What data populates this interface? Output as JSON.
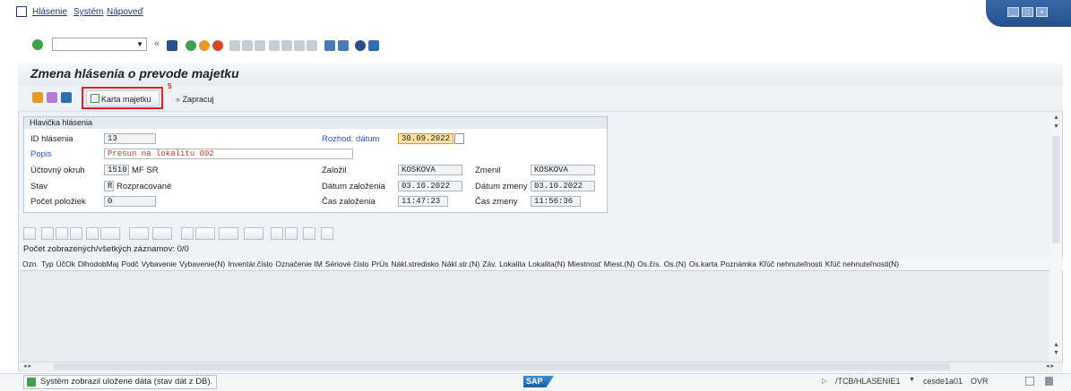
{
  "menu": {
    "items": [
      "Hlásenie",
      "Systém",
      "Nápoveď"
    ]
  },
  "page_title": "Zmena hlásenia o prevode majetku",
  "app_toolbar": {
    "karta_majetku": "Karta majetku",
    "zapracuj": "Zapracuj",
    "step_marker": "5"
  },
  "header_group": {
    "title": "Hlavička hlásenia",
    "id_label": "ID hlásenia",
    "id_value": "13",
    "popis_label": "Popis",
    "popis_value": "Presun na lokalitu 002",
    "uctovny_label": "Účtovný okruh",
    "uctovny_code": "1510",
    "uctovny_name": "MF SR",
    "stav_label": "Stav",
    "stav_code": "R",
    "stav_name": "Rozpracované",
    "pocet_label": "Počet položiek",
    "pocet_value": "0",
    "rozhod_label": "Rozhod. dátum",
    "rozhod_value": "30.09.2022",
    "zalozil_label": "Založil",
    "zalozil_value": "KOSKOVA",
    "zmenil_label": "Zmenil",
    "zmenil_value": "KOSKOVA",
    "datum_zal_label": "Dátum založenia",
    "datum_zal_value": "03.10.2022",
    "datum_zm_label": "Dátum zmeny",
    "datum_zm_value": "03.10.2022",
    "cas_zal_label": "Čas založenia",
    "cas_zal_value": "11:47:23",
    "cas_zm_label": "Čas zmeny",
    "cas_zm_value": "11:56:36"
  },
  "grid": {
    "count_text": "Počet zobrazených/všetkých záznamov: 0/0",
    "columns": [
      "Ozn.",
      "Typ",
      "ÚčOk",
      "DlhodobMaj",
      "Podč",
      "Vybavenie",
      "Vybavenie(N)",
      "Inventár.číslo",
      "Označenie IM",
      "Sériové číslo",
      "PrÚs",
      "Nákl.stredisko",
      "Nákl.str.(N)",
      "Záv.",
      "Lokalita",
      "Lokalita(N)",
      "Miestnosť",
      "Miest.(N)",
      "Os.čís.",
      "Os.(N)",
      "Os.karta",
      "Poznámka",
      "Kľúč nehnuteľnosti",
      "Kľúč nehnuteľnosti(N)"
    ]
  },
  "status": {
    "message": "Systém zobrazil uložené dáta (stav dát z DB).",
    "transaction": "/TCB/HLASENIE1",
    "server": "cesde1a01",
    "mode": "OVR",
    "logo": "SAP"
  },
  "colors": {
    "accent": "#2b56c6",
    "highlight": "#e0211d",
    "date_bg": "#ffe1a6"
  }
}
